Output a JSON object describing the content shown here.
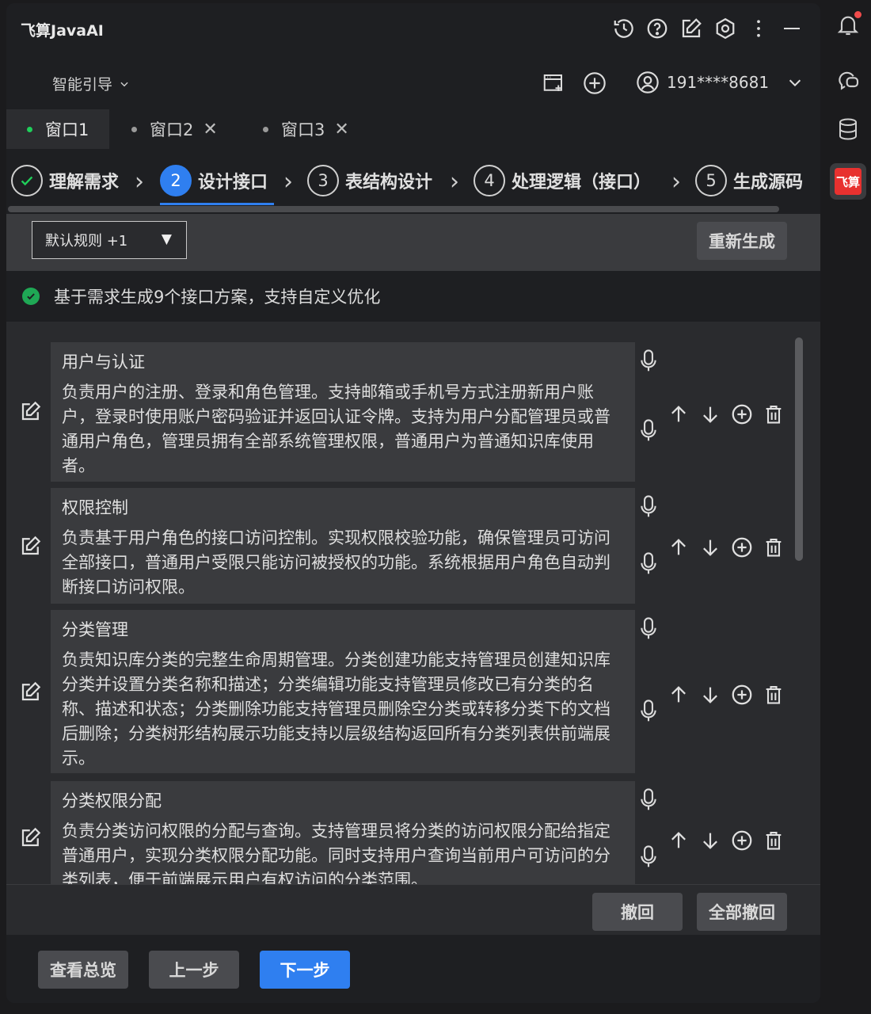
{
  "app": {
    "title": "飞算JavaAI"
  },
  "subbar": {
    "guide_label": "智能引导",
    "account": "191****8681"
  },
  "tabs": [
    {
      "label": "窗口1"
    },
    {
      "label": "窗口2"
    },
    {
      "label": "窗口3"
    }
  ],
  "steps": [
    {
      "num": "",
      "label": "理解需求"
    },
    {
      "num": "2",
      "label": "设计接口"
    },
    {
      "num": "3",
      "label": "表结构设计"
    },
    {
      "num": "4",
      "label": "处理逻辑（接口）"
    },
    {
      "num": "5",
      "label": "生成源码"
    }
  ],
  "rules": {
    "selected": "默认规则 +1",
    "regenerate_label": "重新生成"
  },
  "status": {
    "text": "基于需求生成9个接口方案，支持自定义优化"
  },
  "cards": [
    {
      "title": "用户与认证",
      "desc": "负责用户的注册、登录和角色管理。支持邮箱或手机号方式注册新用户账户，登录时使用账户密码验证并返回认证令牌。支持为用户分配管理员或普通用户角色，管理员拥有全部系统管理权限，普通用户为普通知识库使用者。"
    },
    {
      "title": "权限控制",
      "desc": "负责基于用户角色的接口访问控制。实现权限校验功能，确保管理员可访问全部接口，普通用户受限只能访问被授权的功能。系统根据用户角色自动判断接口访问权限。"
    },
    {
      "title": "分类管理",
      "desc": "负责知识库分类的完整生命周期管理。分类创建功能支持管理员创建知识库分类并设置分类名称和描述；分类编辑功能支持管理员修改已有分类的名称、描述和状态；分类删除功能支持管理员删除空分类或转移分类下的文档后删除；分类树形结构展示功能支持以层级结构返回所有分类列表供前端展示。"
    },
    {
      "title": "分类权限分配",
      "desc": "负责分类访问权限的分配与查询。支持管理员将分类的访问权限分配给指定普通用户，实现分类权限分配功能。同时支持用户查询当前用户可访问的分类列表，便于前端展示用户有权访问的分类范围。"
    }
  ],
  "bottom": {
    "undo_label": "撤回",
    "undo_all_label": "全部撤回"
  },
  "footer": {
    "overview_label": "查看总览",
    "prev_label": "上一步",
    "next_label": "下一步"
  },
  "rail": {
    "brand_text": "飞算"
  },
  "colors": {
    "accent": "#2f7ff0",
    "success": "#1fcf5a",
    "brand": "#e8312f"
  }
}
